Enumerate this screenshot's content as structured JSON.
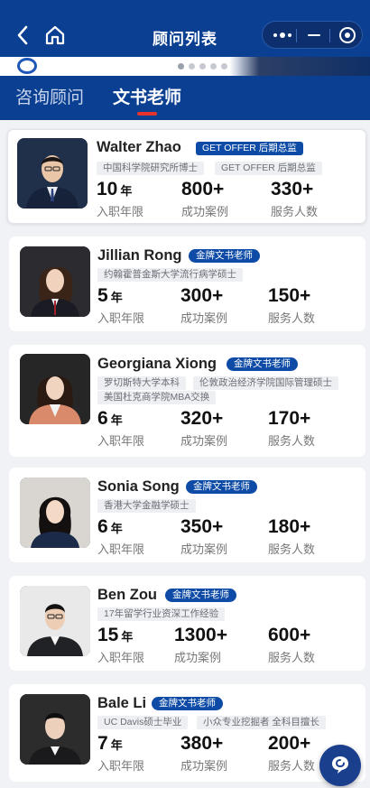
{
  "navbar": {
    "title": "顾问列表",
    "back_icon": "back-arrow-icon",
    "home_icon": "home-icon",
    "capsule": {
      "more_icon": "more-dots-icon",
      "minimize_icon": "minimize-icon",
      "close_icon": "close-circle-icon"
    }
  },
  "tabs": [
    {
      "label": "咨询顾问",
      "active": false
    },
    {
      "label": "文书老师",
      "active": true
    }
  ],
  "stat_labels": {
    "years": "入职年限",
    "cases": "成功案例",
    "served": "服务人数"
  },
  "year_unit": "年",
  "advisors": [
    {
      "name": "Walter Zhao",
      "badge": "GET OFFER 后期总监",
      "tags": [
        "中国科学院研究所博士",
        "GET OFFER 后期总监"
      ],
      "years": "10",
      "cases": "800+",
      "served": "330+"
    },
    {
      "name": "Jillian Rong",
      "badge": "金牌文书老师",
      "tags": [
        "约翰霍普金斯大学流行病学硕士"
      ],
      "years": "5",
      "cases": "300+",
      "served": "150+"
    },
    {
      "name": "Georgiana Xiong",
      "badge": "金牌文书老师",
      "tags": [
        "罗切斯特大学本科",
        "伦敦政治经济学院国际管理硕士",
        "美国杜克商学院MBA交换"
      ],
      "years": "6",
      "cases": "320+",
      "served": "170+"
    },
    {
      "name": "Sonia Song",
      "badge": "金牌文书老师",
      "tags": [
        "香港大学金融学硕士"
      ],
      "years": "6",
      "cases": "350+",
      "served": "180+"
    },
    {
      "name": "Ben Zou",
      "badge": "金牌文书老师",
      "tags": [
        "17年留学行业资深工作经验"
      ],
      "years": "15",
      "cases": "1300+",
      "served": "600+"
    },
    {
      "name": "Bale Li",
      "badge": "金牌文书老师",
      "tags": [
        "UC Davis硕士毕业",
        "小众专业挖掘者 全科目擅长"
      ],
      "years": "7",
      "cases": "380+",
      "served": "200+"
    }
  ],
  "colors": {
    "brand": "#0a3f92",
    "badge": "#0d4ba6",
    "tab_indicator": "#e8332d"
  },
  "fab_icon": "consult-chat-icon"
}
